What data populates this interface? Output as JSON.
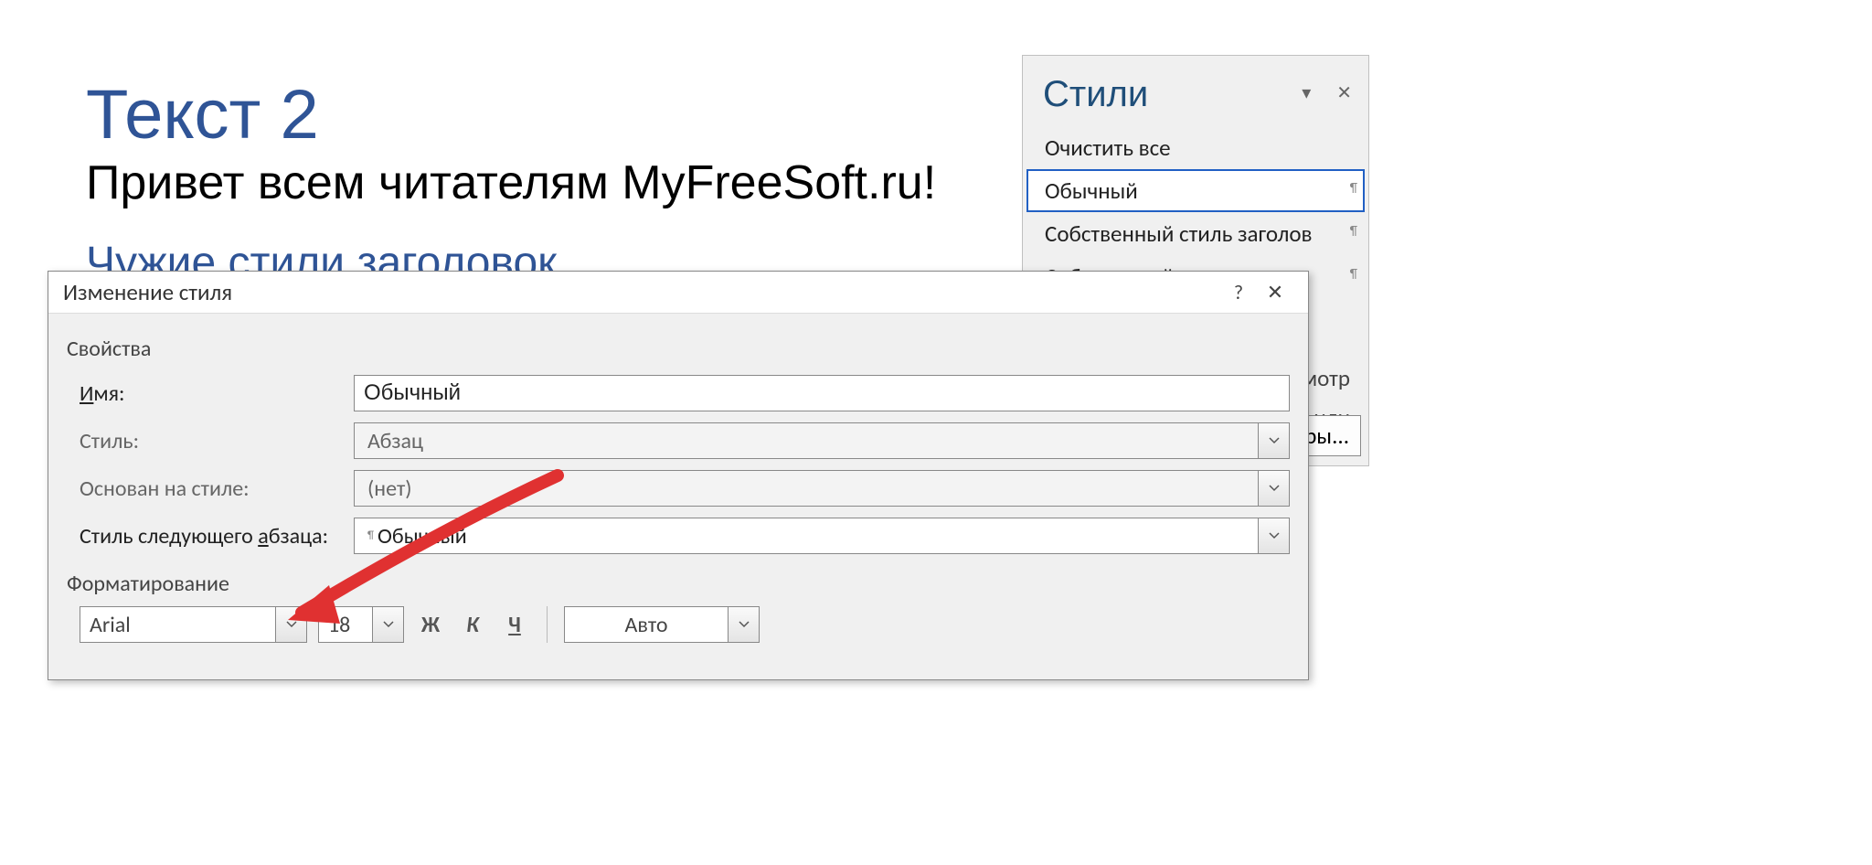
{
  "document": {
    "heading": "Текст 2",
    "line1": "Привет всем читателям MyFreeSoft.ru!",
    "line2": "Чужие стили заголовок"
  },
  "stylesPanel": {
    "title": "Стили",
    "items": [
      {
        "label": "Очистить все",
        "selected": false,
        "pilcrow": false
      },
      {
        "label": "Обычный",
        "selected": true,
        "pilcrow": true
      },
      {
        "label": "Собственный стиль заголов",
        "selected": false,
        "pilcrow": true
      },
      {
        "label": "Собственный стиль текста",
        "selected": false,
        "pilcrow": true
      }
    ],
    "linkPreview": "мотр",
    "linkLinked": "или",
    "paramsButton": "ры..."
  },
  "dialog": {
    "title": "Изменение стиля",
    "help": "?",
    "close": "✕",
    "sections": {
      "properties": "Свойства",
      "formatting": "Форматирование"
    },
    "fields": {
      "nameLabel": "Имя:",
      "nameValue": "Обычный",
      "styleLabel": "Стиль:",
      "styleValue": "Абзац",
      "basedOnLabel": "Основан на стиле:",
      "basedOnValue": "(нет)",
      "nextParaLabel_pre": "Стиль следующего ",
      "nextParaLabel_u": "а",
      "nextParaLabel_post": "бзаца:",
      "nextParaValue": "Обычный"
    },
    "formatting": {
      "font": "Arial",
      "size": "18",
      "bold": "Ж",
      "italic": "К",
      "underline": "Ч",
      "auto": "Авто"
    }
  }
}
